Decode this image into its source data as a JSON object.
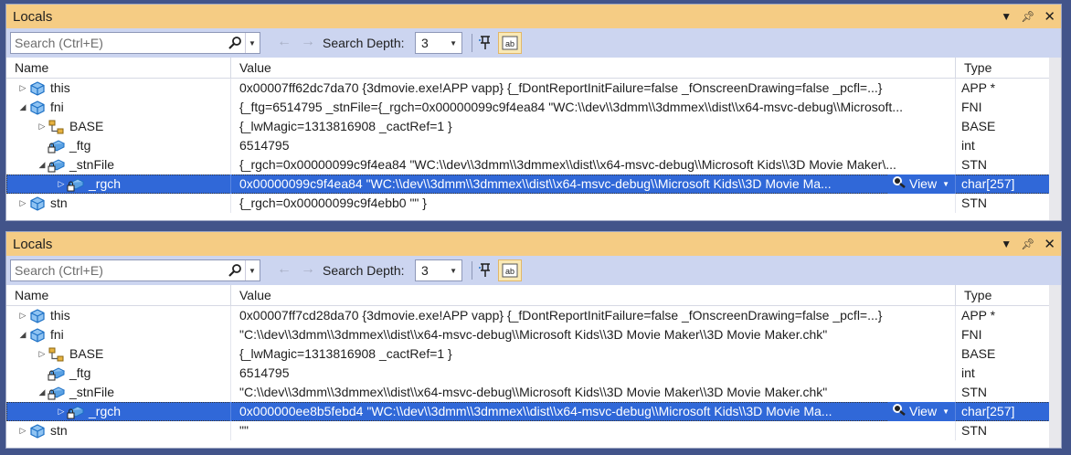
{
  "panels": [
    {
      "title": "Locals",
      "search": {
        "placeholder": "Search (Ctrl+E)"
      },
      "search_depth": {
        "label": "Search Depth:",
        "value": "3"
      },
      "columns": {
        "name": "Name",
        "value": "Value",
        "type": "Type"
      },
      "view_label": "View",
      "rows": [
        {
          "name": "this",
          "value": "0x00007ff62dc7da70 {3dmovie.exe!APP vapp} {_fDontReportInitFailure=false _fOnscreenDrawing=false _pcfl=...}",
          "type": "APP *",
          "indent": 0,
          "expander": "▷",
          "icon": "object-icon",
          "selected": false
        },
        {
          "name": "fni",
          "value": "{_ftg=6514795 _stnFile={_rgch=0x00000099c9f4ea84 \"WC:\\\\dev\\\\3dmm\\\\3dmmex\\\\dist\\\\x64-msvc-debug\\\\Microsoft...",
          "type": "FNI",
          "indent": 0,
          "expander": "◢",
          "icon": "object-icon",
          "selected": false
        },
        {
          "name": "BASE",
          "value": "{_lwMagic=1313816908 _cactRef=1 }",
          "type": "BASE",
          "indent": 1,
          "expander": "▷",
          "icon": "base-class-icon",
          "selected": false
        },
        {
          "name": "_ftg",
          "value": "6514795",
          "type": "int",
          "indent": 1,
          "expander": "",
          "icon": "private-field-icon",
          "selected": false
        },
        {
          "name": "_stnFile",
          "value": "{_rgch=0x00000099c9f4ea84 \"WC:\\\\dev\\\\3dmm\\\\3dmmex\\\\dist\\\\x64-msvc-debug\\\\Microsoft Kids\\\\3D Movie Maker\\...",
          "type": "STN",
          "indent": 1,
          "expander": "◢",
          "icon": "private-field-icon",
          "selected": false
        },
        {
          "name": "_rgch",
          "value": "0x00000099c9f4ea84 \"WC:\\\\dev\\\\3dmm\\\\3dmmex\\\\dist\\\\x64-msvc-debug\\\\Microsoft Kids\\\\3D Movie Ma...",
          "type": "char[257]",
          "indent": 2,
          "expander": "▷",
          "icon": "private-field-icon",
          "selected": true
        },
        {
          "name": "stn",
          "value": "{_rgch=0x00000099c9f4ebb0 \"\" }",
          "type": "STN",
          "indent": 0,
          "expander": "▷",
          "icon": "object-icon",
          "selected": false
        }
      ]
    },
    {
      "title": "Locals",
      "search": {
        "placeholder": "Search (Ctrl+E)"
      },
      "search_depth": {
        "label": "Search Depth:",
        "value": "3"
      },
      "columns": {
        "name": "Name",
        "value": "Value",
        "type": "Type"
      },
      "view_label": "View",
      "rows": [
        {
          "name": "this",
          "value": "0x00007ff7cd28da70 {3dmovie.exe!APP vapp} {_fDontReportInitFailure=false _fOnscreenDrawing=false _pcfl=...}",
          "type": "APP *",
          "indent": 0,
          "expander": "▷",
          "icon": "object-icon",
          "selected": false
        },
        {
          "name": "fni",
          "value": "\"C:\\\\dev\\\\3dmm\\\\3dmmex\\\\dist\\\\x64-msvc-debug\\\\Microsoft Kids\\\\3D Movie Maker\\\\3D Movie Maker.chk\"",
          "type": "FNI",
          "indent": 0,
          "expander": "◢",
          "icon": "object-icon",
          "selected": false
        },
        {
          "name": "BASE",
          "value": "{_lwMagic=1313816908 _cactRef=1 }",
          "type": "BASE",
          "indent": 1,
          "expander": "▷",
          "icon": "base-class-icon",
          "selected": false
        },
        {
          "name": "_ftg",
          "value": "6514795",
          "type": "int",
          "indent": 1,
          "expander": "",
          "icon": "private-field-icon",
          "selected": false
        },
        {
          "name": "_stnFile",
          "value": "\"C:\\\\dev\\\\3dmm\\\\3dmmex\\\\dist\\\\x64-msvc-debug\\\\Microsoft Kids\\\\3D Movie Maker\\\\3D Movie Maker.chk\"",
          "type": "STN",
          "indent": 1,
          "expander": "◢",
          "icon": "private-field-icon",
          "selected": false
        },
        {
          "name": "_rgch",
          "value": "0x000000ee8b5febd4 \"WC:\\\\dev\\\\3dmm\\\\3dmmex\\\\dist\\\\x64-msvc-debug\\\\Microsoft Kids\\\\3D Movie Ma...",
          "type": "char[257]",
          "indent": 2,
          "expander": "▷",
          "icon": "private-field-icon",
          "selected": true
        },
        {
          "name": "stn",
          "value": "\"\"",
          "type": "STN",
          "indent": 0,
          "expander": "▷",
          "icon": "object-icon",
          "selected": false
        }
      ]
    }
  ]
}
